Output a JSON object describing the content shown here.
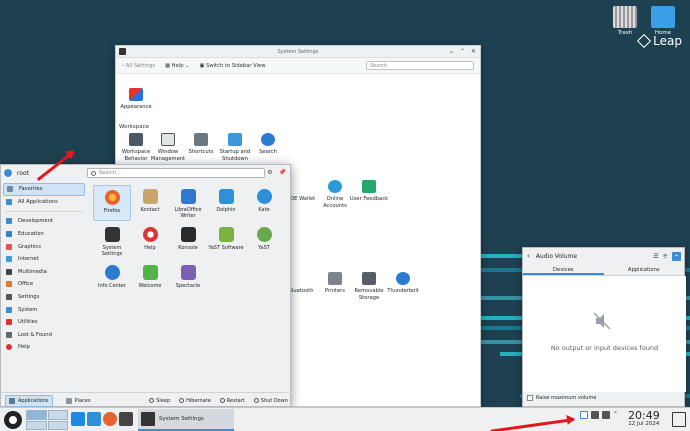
{
  "desktop": {
    "icons": [
      {
        "label": "Trash",
        "icon": "trash-icon"
      },
      {
        "label": "Home",
        "icon": "home-folder-icon"
      }
    ],
    "brand": "Leap"
  },
  "settings_window": {
    "title": "System Settings",
    "toolbar": {
      "back_label": "All Settings",
      "help_label": "Help",
      "sidebar_label": "Switch to Sidebar View",
      "search_placeholder": "Search"
    },
    "top_items": [
      {
        "label": "Appearance"
      }
    ],
    "workspace_title": "Workspace",
    "workspace_items": [
      {
        "label": "Workspace Behavior"
      },
      {
        "label": "Window Management"
      },
      {
        "label": "Shortcuts"
      },
      {
        "label": "Startup and Shutdown"
      },
      {
        "label": "Search"
      }
    ],
    "row2_items": [
      {
        "label": "KDE Wallet"
      },
      {
        "label": "Online Accounts"
      },
      {
        "label": "User Feedback"
      }
    ],
    "row3_items": [
      {
        "label": "Bluetooth"
      },
      {
        "label": "Printers"
      },
      {
        "label": "Removable Storage"
      },
      {
        "label": "Thunderbolt"
      }
    ]
  },
  "kickoff": {
    "user": "root",
    "search_placeholder": "Search...",
    "categories": [
      {
        "label": "Favorites",
        "active": true,
        "color": "#6f8aa3"
      },
      {
        "label": "All Applications",
        "color": "#3d8ad6"
      },
      {
        "label": "Development",
        "color": "#3d8ad6"
      },
      {
        "label": "Education",
        "color": "#2f7fcf"
      },
      {
        "label": "Graphics",
        "color": "#e25555"
      },
      {
        "label": "Internet",
        "color": "#3a9be0"
      },
      {
        "label": "Multimedia",
        "color": "#444"
      },
      {
        "label": "Office",
        "color": "#e07a2f"
      },
      {
        "label": "Settings",
        "color": "#555"
      },
      {
        "label": "System",
        "color": "#3d8ad6"
      },
      {
        "label": "Utilities",
        "color": "#d33"
      },
      {
        "label": "Lost & Found",
        "color": "#666"
      },
      {
        "label": "Help",
        "color": "#d33"
      }
    ],
    "apps": [
      {
        "label": "Firefox",
        "color": "#e8642c"
      },
      {
        "label": "Kontact",
        "color": "#c9a56b"
      },
      {
        "label": "LibreOffice Writer",
        "color": "#2f78d0"
      },
      {
        "label": "Dolphin",
        "color": "#2e90d6"
      },
      {
        "label": "Kate",
        "color": "#2f8fd8"
      },
      {
        "label": "System Settings",
        "color": "#333"
      },
      {
        "label": "Help",
        "color": "#d33"
      },
      {
        "label": "Konsole",
        "color": "#2b2b2b"
      },
      {
        "label": "YaST Software",
        "color": "#7bb342"
      },
      {
        "label": "YaST",
        "color": "#6aa84f"
      },
      {
        "label": "Info Center",
        "color": "#2b7bd0"
      },
      {
        "label": "Welcome",
        "color": "#53b34a"
      },
      {
        "label": "Spectacle",
        "color": "#7d5fb8"
      }
    ],
    "footer": {
      "applications_label": "Applications",
      "places_label": "Places",
      "sleep_label": "Sleep",
      "hibernate_label": "Hibernate",
      "restart_label": "Restart",
      "shutdown_label": "Shut Down"
    }
  },
  "audio": {
    "title": "Audio Volume",
    "tab_devices": "Devices",
    "tab_applications": "Applications",
    "message": "No output or input devices found",
    "raise_label": "Raise maximum volume"
  },
  "taskbar": {
    "task_label": "System Settings",
    "time": "20:49",
    "date": "12 Jul 2024"
  }
}
